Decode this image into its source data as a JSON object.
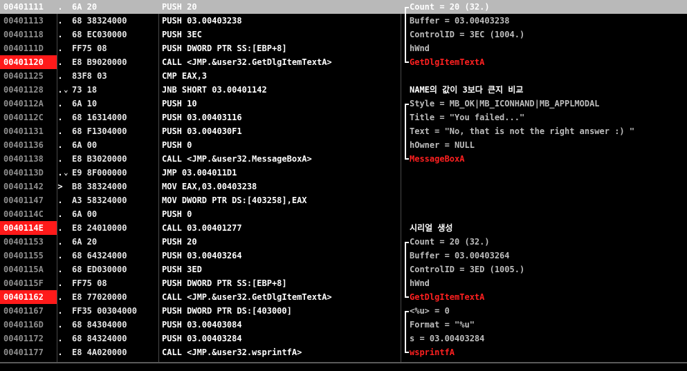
{
  "rows": [
    {
      "addr": "00401111",
      "mark": ".",
      "jump": "",
      "bytes": "6A 20",
      "instr": "PUSH 20",
      "comment": "Count = 20 (32.)",
      "ctype": "arg",
      "bracket": "top",
      "bp": false,
      "selected": true
    },
    {
      "addr": "00401113",
      "mark": ".",
      "jump": "",
      "bytes": "68 38324000",
      "instr": "PUSH 03.00403238",
      "comment": "Buffer = 03.00403238",
      "ctype": "arg",
      "bracket": "mid",
      "bp": false,
      "selected": false
    },
    {
      "addr": "00401118",
      "mark": ".",
      "jump": "",
      "bytes": "68 EC030000",
      "instr": "PUSH 3EC",
      "comment": "ControlID = 3EC (1004.)",
      "ctype": "arg",
      "bracket": "mid",
      "bp": false,
      "selected": false
    },
    {
      "addr": "0040111D",
      "mark": ".",
      "jump": "",
      "bytes": "FF75 08",
      "instr": "PUSH DWORD PTR SS:[EBP+8]",
      "comment": "hWnd",
      "ctype": "arg",
      "bracket": "mid",
      "bp": false,
      "selected": false
    },
    {
      "addr": "00401120",
      "mark": ".",
      "jump": "",
      "bytes": "E8 B9020000",
      "instr": "CALL <JMP.&user32.GetDlgItemTextA>",
      "comment": "GetDlgItemTextA",
      "ctype": "fn",
      "bracket": "bot",
      "bp": true,
      "selected": false
    },
    {
      "addr": "00401125",
      "mark": ".",
      "jump": "",
      "bytes": "83F8 03",
      "instr": "CMP EAX,3",
      "comment": "",
      "ctype": "arg",
      "bracket": "",
      "bp": false,
      "selected": false
    },
    {
      "addr": "00401128",
      "mark": ".",
      "jump": "v",
      "bytes": "73 18",
      "instr": "JNB SHORT 03.00401142",
      "comment": "NAME의 값이 3보다 큰지 비교",
      "ctype": "title",
      "bracket": "",
      "bp": false,
      "selected": false
    },
    {
      "addr": "0040112A",
      "mark": ".",
      "jump": "",
      "bytes": "6A 10",
      "instr": "PUSH 10",
      "comment": "Style = MB_OK|MB_ICONHAND|MB_APPLMODAL",
      "ctype": "arg",
      "bracket": "top",
      "bp": false,
      "selected": false
    },
    {
      "addr": "0040112C",
      "mark": ".",
      "jump": "",
      "bytes": "68 16314000",
      "instr": "PUSH 03.00403116",
      "comment": "Title = \"You failed...\"",
      "ctype": "arg",
      "bracket": "mid",
      "bp": false,
      "selected": false
    },
    {
      "addr": "00401131",
      "mark": ".",
      "jump": "",
      "bytes": "68 F1304000",
      "instr": "PUSH 03.004030F1",
      "comment": "Text = \"No, that is not the right answer :) \"",
      "ctype": "arg",
      "bracket": "mid",
      "bp": false,
      "selected": false
    },
    {
      "addr": "00401136",
      "mark": ".",
      "jump": "",
      "bytes": "6A 00",
      "instr": "PUSH 0",
      "comment": "hOwner = NULL",
      "ctype": "arg",
      "bracket": "mid",
      "bp": false,
      "selected": false
    },
    {
      "addr": "00401138",
      "mark": ".",
      "jump": "",
      "bytes": "E8 B3020000",
      "instr": "CALL <JMP.&user32.MessageBoxA>",
      "comment": "MessageBoxA",
      "ctype": "fn",
      "bracket": "bot",
      "bp": false,
      "selected": false
    },
    {
      "addr": "0040113D",
      "mark": ".",
      "jump": "v",
      "bytes": "E9 8F000000",
      "instr": "JMP 03.004011D1",
      "comment": "",
      "ctype": "arg",
      "bracket": "",
      "bp": false,
      "selected": false
    },
    {
      "addr": "00401142",
      "mark": ">",
      "jump": "",
      "bytes": "B8 38324000",
      "instr": "MOV EAX,03.00403238",
      "comment": "",
      "ctype": "arg",
      "bracket": "",
      "bp": false,
      "selected": false
    },
    {
      "addr": "00401147",
      "mark": ".",
      "jump": "",
      "bytes": "A3 58324000",
      "instr": "MOV DWORD PTR DS:[403258],EAX",
      "comment": "",
      "ctype": "arg",
      "bracket": "",
      "bp": false,
      "selected": false
    },
    {
      "addr": "0040114C",
      "mark": ".",
      "jump": "",
      "bytes": "6A 00",
      "instr": "PUSH 0",
      "comment": "",
      "ctype": "arg",
      "bracket": "",
      "bp": false,
      "selected": false
    },
    {
      "addr": "0040114E",
      "mark": ".",
      "jump": "",
      "bytes": "E8 24010000",
      "instr": "CALL 03.00401277",
      "comment": "시리얼 생성",
      "ctype": "title",
      "bracket": "",
      "bp": true,
      "selected": false
    },
    {
      "addr": "00401153",
      "mark": ".",
      "jump": "",
      "bytes": "6A 20",
      "instr": "PUSH 20",
      "comment": "Count = 20 (32.)",
      "ctype": "arg",
      "bracket": "top",
      "bp": false,
      "selected": false
    },
    {
      "addr": "00401155",
      "mark": ".",
      "jump": "",
      "bytes": "68 64324000",
      "instr": "PUSH 03.00403264",
      "comment": "Buffer = 03.00403264",
      "ctype": "arg",
      "bracket": "mid",
      "bp": false,
      "selected": false
    },
    {
      "addr": "0040115A",
      "mark": ".",
      "jump": "",
      "bytes": "68 ED030000",
      "instr": "PUSH 3ED",
      "comment": "ControlID = 3ED (1005.)",
      "ctype": "arg",
      "bracket": "mid",
      "bp": false,
      "selected": false
    },
    {
      "addr": "0040115F",
      "mark": ".",
      "jump": "",
      "bytes": "FF75 08",
      "instr": "PUSH DWORD PTR SS:[EBP+8]",
      "comment": "hWnd",
      "ctype": "arg",
      "bracket": "mid",
      "bp": false,
      "selected": false
    },
    {
      "addr": "00401162",
      "mark": ".",
      "jump": "",
      "bytes": "E8 77020000",
      "instr": "CALL <JMP.&user32.GetDlgItemTextA>",
      "comment": "GetDlgItemTextA",
      "ctype": "fn",
      "bracket": "bot",
      "bp": true,
      "selected": false
    },
    {
      "addr": "00401167",
      "mark": ".",
      "jump": "",
      "bytes": "FF35 00304000",
      "instr": "PUSH DWORD PTR DS:[403000]",
      "comment": "<%u> = 0",
      "ctype": "arg",
      "bracket": "top",
      "bp": false,
      "selected": false
    },
    {
      "addr": "0040116D",
      "mark": ".",
      "jump": "",
      "bytes": "68 84304000",
      "instr": "PUSH 03.00403084",
      "comment": "Format = \"%u\"",
      "ctype": "arg",
      "bracket": "mid",
      "bp": false,
      "selected": false
    },
    {
      "addr": "00401172",
      "mark": ".",
      "jump": "",
      "bytes": "68 84324000",
      "instr": "PUSH 03.00403284",
      "comment": "s = 03.00403284",
      "ctype": "arg",
      "bracket": "mid",
      "bp": false,
      "selected": false
    },
    {
      "addr": "00401177",
      "mark": ".",
      "jump": "",
      "bytes": "E8 4A020000",
      "instr": "CALL <JMP.&user32.wsprintfA>",
      "comment": "wsprintfA",
      "ctype": "fn",
      "bracket": "bot",
      "bp": false,
      "selected": false
    }
  ],
  "colors": {
    "background": "#000000",
    "breakpoint": "#ff1a1a",
    "selection": "#b9b9b9",
    "function_comment": "#ff2020",
    "address": "#8e8e8e"
  }
}
